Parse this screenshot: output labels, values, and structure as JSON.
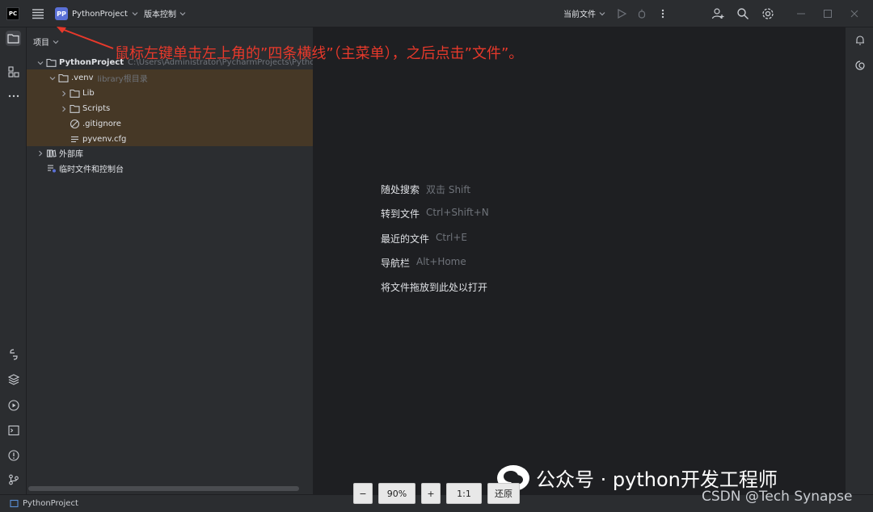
{
  "titlebar": {
    "app_logo": "PC",
    "project_badge": "PP",
    "project_name": "PythonProject",
    "vcs_label": "版本控制",
    "run_config": "当前文件"
  },
  "annotation": {
    "text": "鼠标左键单击左上角的”四条横线”（主菜单），之后点击”文件”。",
    "color": "#e8392b"
  },
  "project_panel": {
    "header": "项目",
    "root": {
      "name": "PythonProject",
      "path": "C:\\Users\\Administrator\\PycharmProjects\\PythonProjec"
    },
    "venv": {
      "name": ".venv",
      "hint": "library根目录"
    },
    "items": [
      {
        "name": "Lib"
      },
      {
        "name": "Scripts"
      },
      {
        "name": ".gitignore"
      },
      {
        "name": "pyvenv.cfg"
      }
    ],
    "external_libs": "外部库",
    "scratches": "临时文件和控制台",
    "highlight_color": "#4b3b24"
  },
  "editor_hints": [
    {
      "label": "随处搜索",
      "key": "双击 Shift"
    },
    {
      "label": "转到文件",
      "key": "Ctrl+Shift+N"
    },
    {
      "label": "最近的文件",
      "key": "Ctrl+E"
    },
    {
      "label": "导航栏",
      "key": "Alt+Home"
    },
    {
      "label": "将文件拖放到此处以打开",
      "key": ""
    }
  ],
  "statusbar": {
    "project": "PythonProject"
  },
  "zoom": {
    "minus": "−",
    "level": "90%",
    "plus": "+",
    "actual": "1:1",
    "restore": "还原"
  },
  "watermark": {
    "line1": "公众号 · python开发工程师",
    "line2": "CSDN @Tech Synapse"
  },
  "colors": {
    "accent": "#5a70d6",
    "background": "#1e1f22",
    "panel": "#2b2d30"
  }
}
